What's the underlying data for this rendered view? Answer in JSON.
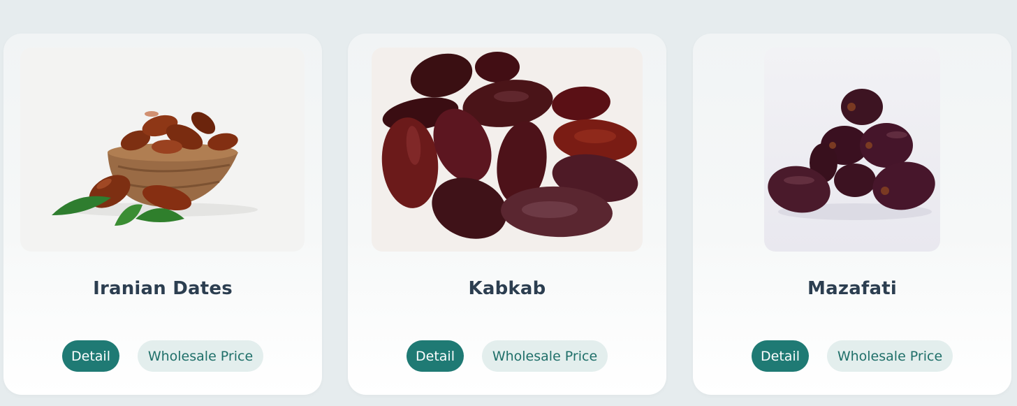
{
  "products": [
    {
      "title": "Iranian Dates",
      "detail_label": "Detail",
      "wholesale_label": "Wholesale Price",
      "image": "dates-in-wooden-bowl-image"
    },
    {
      "title": "Kabkab",
      "detail_label": "Detail",
      "wholesale_label": "Wholesale Price",
      "image": "kabkab-dates-pile-image"
    },
    {
      "title": "Mazafati",
      "detail_label": "Detail",
      "wholesale_label": "Wholesale Price",
      "image": "mazafati-dates-stack-image"
    }
  ],
  "colors": {
    "background": "#e6ecee",
    "primary_button": "#1f7a74",
    "secondary_button": "#e3eeed",
    "title_text": "#2c3e50"
  }
}
